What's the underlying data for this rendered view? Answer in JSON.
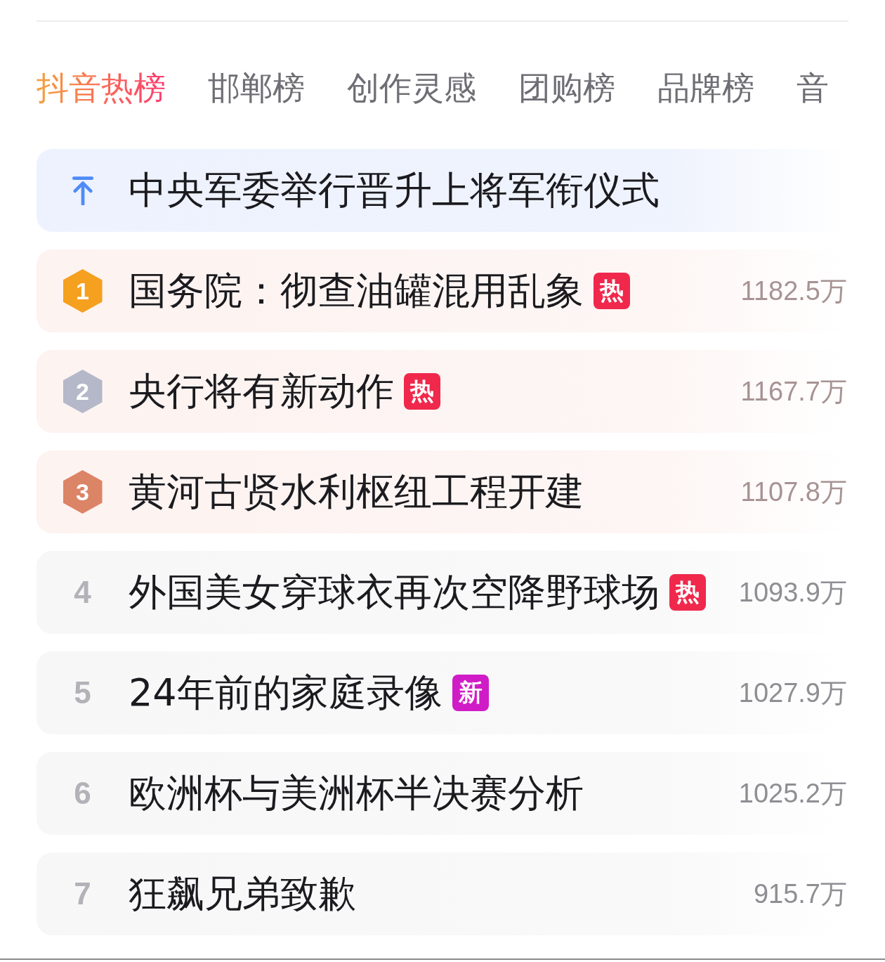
{
  "tabs": [
    {
      "label": "抖音热榜",
      "selected": true
    },
    {
      "label": "邯郸榜",
      "selected": false
    },
    {
      "label": "创作灵感",
      "selected": false
    },
    {
      "label": "团购榜",
      "selected": false
    },
    {
      "label": "品牌榜",
      "selected": false
    },
    {
      "label": "音",
      "selected": false
    }
  ],
  "hot_list": [
    {
      "kind": "pinned",
      "title": "中央军委举行晋升上将军衔仪式"
    },
    {
      "kind": "medal",
      "rank": "1",
      "color": "#f5a01e",
      "title": "国务院：彻查油罐混用乱象",
      "tag": {
        "text": "热",
        "color": "#f0284c"
      },
      "count": "1182.5万"
    },
    {
      "kind": "medal",
      "rank": "2",
      "color": "#b5b8c8",
      "title": "央行将有新动作",
      "tag": {
        "text": "热",
        "color": "#f0284c"
      },
      "count": "1167.7万"
    },
    {
      "kind": "medal",
      "rank": "3",
      "color": "#dc8466",
      "title": "黄河古贤水利枢纽工程开建",
      "count": "1107.8万"
    },
    {
      "kind": "plain",
      "rank": "4",
      "title": "外国美女穿球衣再次空降野球场",
      "tag": {
        "text": "热",
        "color": "#f0284c"
      },
      "count": "1093.9万"
    },
    {
      "kind": "plain",
      "rank": "5",
      "title": "24年前的家庭录像",
      "tag": {
        "text": "新",
        "color": "#d01cc6"
      },
      "count": "1027.9万"
    },
    {
      "kind": "plain",
      "rank": "6",
      "title": "欧洲杯与美洲杯半决赛分析",
      "count": "1025.2万"
    },
    {
      "kind": "plain",
      "rank": "7",
      "title": "狂飙兄弟致歉",
      "count": "915.7万"
    }
  ]
}
